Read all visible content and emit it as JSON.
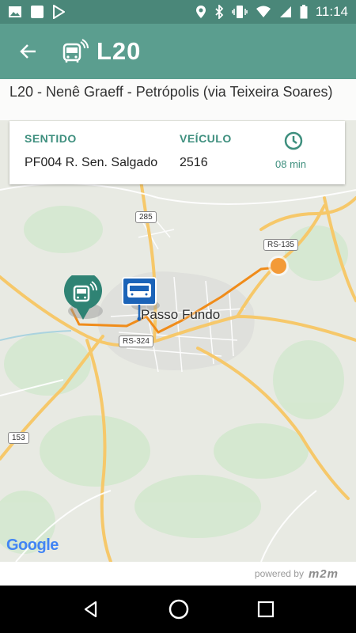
{
  "status_bar": {
    "time": "11:14",
    "left_icons": [
      "image-icon",
      "square-icon",
      "play-store-icon"
    ],
    "right_icons": [
      "location-icon",
      "bluetooth-icon",
      "vibrate-icon",
      "wifi-icon",
      "signal-icon",
      "battery-icon"
    ]
  },
  "app_bar": {
    "title": "L20",
    "back_icon": "arrow-left-icon",
    "bus_icon": "bus-signal-icon",
    "color": "#5b9e8f"
  },
  "route": {
    "title": "L20 - Nenê Graeff - Petrópolis (via Teixeira Soares)"
  },
  "info_card": {
    "direction_header": "SENTIDO",
    "direction_value": "PF004 R. Sen. Salgado",
    "vehicle_header": "VEÍCULO",
    "vehicle_value": "2516",
    "eta_value": "08 min",
    "accent": "#3e8f7e"
  },
  "map": {
    "city": "Passo Fundo",
    "road_labels": [
      "285",
      "RS-135",
      "RS-324",
      "153"
    ],
    "attribution": "Google"
  },
  "footer": {
    "powered_by": "powered by",
    "brand": "m2m"
  },
  "nav_bar": {
    "icons": [
      "back-triangle-icon",
      "home-circle-icon",
      "recents-square-icon"
    ]
  }
}
